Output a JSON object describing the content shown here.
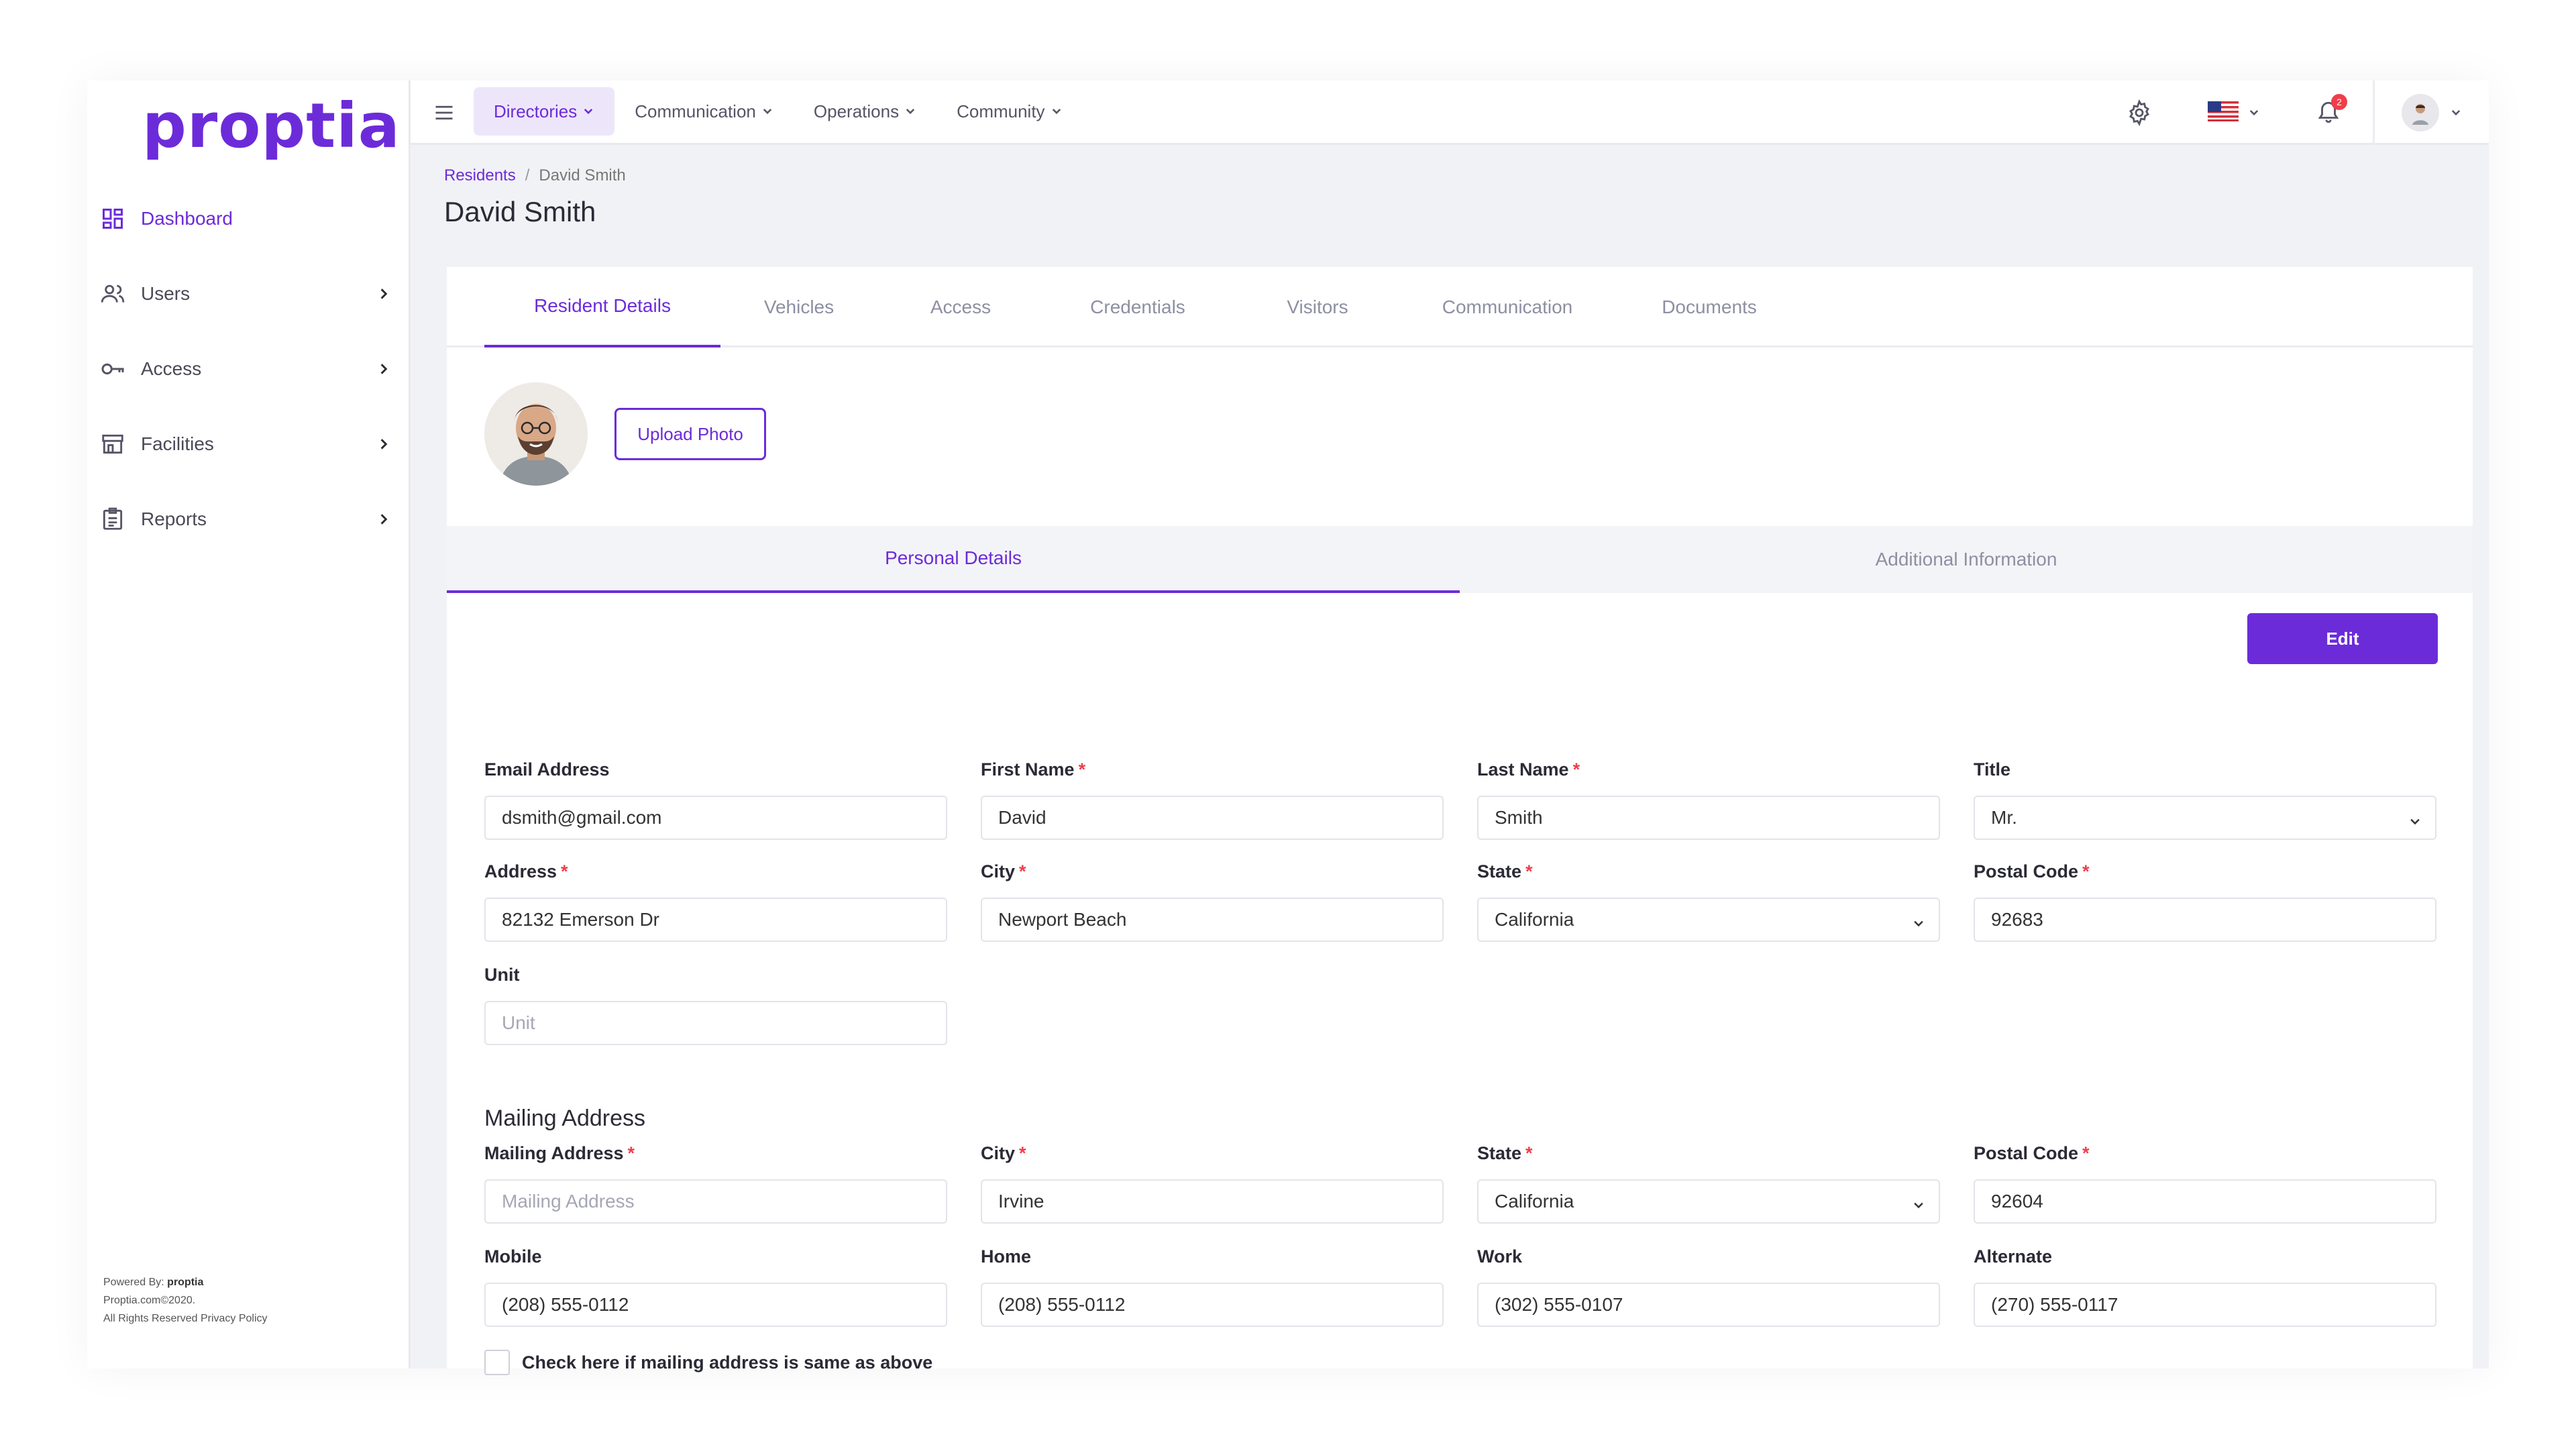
{
  "brand": {
    "logo": "proptia",
    "accent": "#6c2bd9"
  },
  "sidebar": {
    "items": [
      {
        "label": "Dashboard",
        "icon": "dashboard-icon",
        "active": true
      },
      {
        "label": "Users",
        "icon": "users-icon"
      },
      {
        "label": "Access",
        "icon": "key-icon"
      },
      {
        "label": "Facilities",
        "icon": "building-icon"
      },
      {
        "label": "Reports",
        "icon": "report-icon"
      }
    ],
    "footer": {
      "powered_by": "Powered By:",
      "powered_brand": "proptia",
      "copyright": "Proptia.com©2020.",
      "rights": "All Rights Reserved Privacy Policy"
    }
  },
  "topbar": {
    "menu": [
      {
        "label": "Directories"
      },
      {
        "label": "Communication"
      },
      {
        "label": "Operations"
      },
      {
        "label": "Community"
      }
    ],
    "notifications_count": "2"
  },
  "breadcrumb": {
    "parent": "Residents",
    "sep": "/",
    "current": "David Smith"
  },
  "page_title": "David Smith",
  "tabs": [
    "Resident Details",
    "Vehicles",
    "Access",
    "Credentials",
    "Visitors",
    "Communication",
    "Documents"
  ],
  "upload_label": "Upload Photo",
  "subtabs": [
    "Personal Details",
    "Additional Information"
  ],
  "edit_label": "Edit",
  "fields": {
    "email": {
      "label": "Email Address",
      "value": "dsmith@gmail.com"
    },
    "first_name": {
      "label": "First Name",
      "value": "David"
    },
    "last_name": {
      "label": "Last Name",
      "value": "Smith"
    },
    "title": {
      "label": "Title",
      "value": "Mr."
    },
    "address": {
      "label": "Address",
      "value": "82132 Emerson Dr"
    },
    "city": {
      "label": "City",
      "value": "Newport Beach"
    },
    "state": {
      "label": "State",
      "value": "California"
    },
    "postal": {
      "label": "Postal Code",
      "value": "92683"
    },
    "unit": {
      "label": "Unit",
      "placeholder": "Unit"
    }
  },
  "mailing": {
    "section_title": "Mailing Address",
    "mailing_address": {
      "label": "Mailing Address",
      "placeholder": "Mailing Address"
    },
    "city": {
      "label": "City",
      "value": "Irvine"
    },
    "state": {
      "label": "State",
      "value": "California"
    },
    "postal": {
      "label": "Postal Code",
      "value": "92604"
    },
    "mobile": {
      "label": "Mobile",
      "value": "(208) 555-0112"
    },
    "home": {
      "label": "Home",
      "value": "(208) 555-0112"
    },
    "work": {
      "label": "Work",
      "value": "(302) 555-0107"
    },
    "alternate": {
      "label": "Alternate",
      "value": "(270) 555-0117"
    }
  },
  "same_address_label": "Check here if mailing address is same as above"
}
